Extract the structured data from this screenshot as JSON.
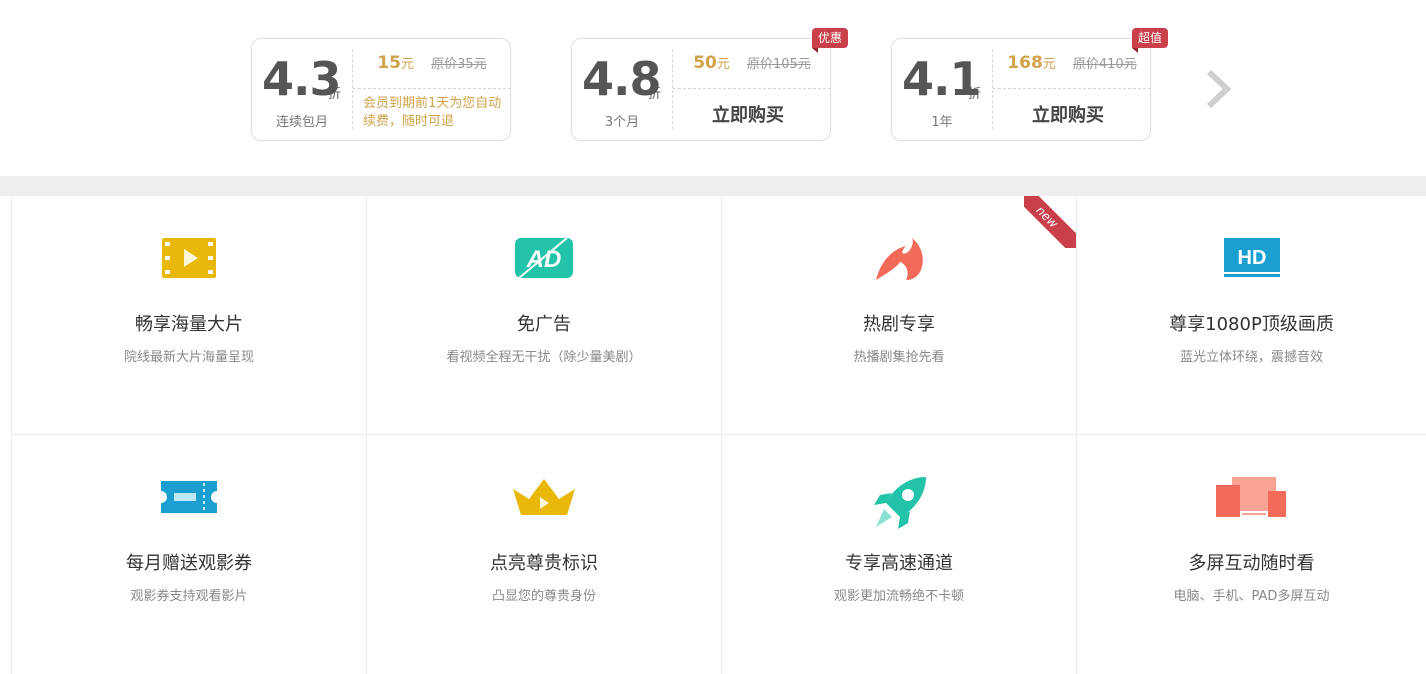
{
  "plans": [
    {
      "discount": "4.3",
      "zhe": "折",
      "period": "连续包月",
      "price": "15",
      "unit": "元",
      "original": "原价35元",
      "note": "会员到期前1天为您自动续费，随时可退",
      "badge": ""
    },
    {
      "discount": "4.8",
      "zhe": "折",
      "period": "3个月",
      "price": "50",
      "unit": "元",
      "original": "原价105元",
      "buy_label": "立即购买",
      "badge": "优惠"
    },
    {
      "discount": "4.1",
      "zhe": "折",
      "period": "1年",
      "price": "168",
      "unit": "元",
      "original": "原价410元",
      "buy_label": "立即购买",
      "badge": "超值"
    }
  ],
  "next_icon": "chevron-right-icon",
  "features": [
    {
      "icon": "film-icon",
      "title": "畅享海量大片",
      "desc": "院线最新大片海量呈现",
      "icon_color": "#e8b90a"
    },
    {
      "icon": "ad-free-icon",
      "title": "免广告",
      "desc": "看视频全程无干扰（除少量美剧）",
      "icon_color": "#22c3a8",
      "icon_text": "AD"
    },
    {
      "icon": "flame-icon",
      "title": "热剧专享",
      "desc": "热播剧集抢先看",
      "icon_color": "#f26a5a",
      "corner": "new"
    },
    {
      "icon": "hd-icon",
      "title": "尊享1080P顶级画质",
      "desc": "蓝光立体环绕，震撼音效",
      "icon_color": "#1a9fd0",
      "icon_text": "HD"
    },
    {
      "icon": "ticket-icon",
      "title": "每月赠送观影券",
      "desc": "观影券支持观看影片",
      "icon_color": "#1a9fd0"
    },
    {
      "icon": "crown-icon",
      "title": "点亮尊贵标识",
      "desc": "凸显您的尊贵身份",
      "icon_color": "#e8b90a"
    },
    {
      "icon": "rocket-icon",
      "title": "专享高速通道",
      "desc": "观影更加流畅绝不卡顿",
      "icon_color": "#22c3a8"
    },
    {
      "icon": "multi-screen-icon",
      "title": "多屏互动随时看",
      "desc": "电脑、手机、PAD多屏互动",
      "icon_color": "#f26a5a"
    }
  ]
}
